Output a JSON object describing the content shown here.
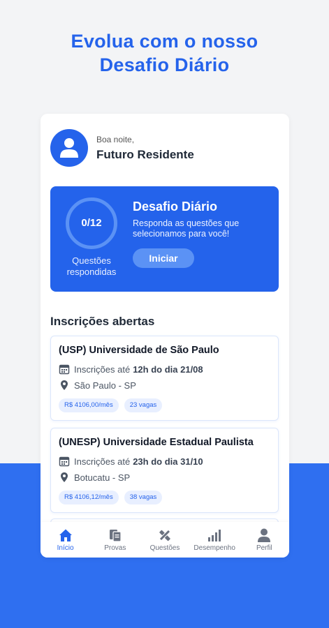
{
  "headline": {
    "line1": "Evolua com o nosso",
    "line2": "Desafio Diário"
  },
  "greeting": {
    "salutation": "Boa noite,",
    "name": "Futuro Residente"
  },
  "challenge": {
    "progress_text": "0/12",
    "progress_fraction": 0,
    "caption_line1": "Questões",
    "caption_line2": "respondidas",
    "title": "Desafio Diário",
    "description": "Responda as questões que selecionamos para você!",
    "button_label": "Iniciar"
  },
  "section_title": "Inscrições abertas",
  "cards": [
    {
      "title": "(USP) Universidade de São Paulo",
      "deadline_prefix": "Inscrições até",
      "deadline_value": "12h do dia 21/08",
      "location": "São Paulo - SP",
      "salary": "R$ 4106,00/mês",
      "vacancies": "23 vagas"
    },
    {
      "title": "(UNESP) Universidade Estadual Paulista",
      "deadline_prefix": "Inscrições até",
      "deadline_value": "23h do dia 31/10",
      "location": "Botucatu - SP",
      "salary": "R$ 4106,12/mês",
      "vacancies": "38 vagas"
    }
  ],
  "nav": [
    {
      "label": "Início",
      "icon": "home-icon",
      "active": true
    },
    {
      "label": "Provas",
      "icon": "documents-icon",
      "active": false
    },
    {
      "label": "Questões",
      "icon": "pencil-ruler-icon",
      "active": false
    },
    {
      "label": "Desempenho",
      "icon": "bar-chart-icon",
      "active": false
    },
    {
      "label": "Perfil",
      "icon": "person-icon",
      "active": false
    }
  ],
  "colors": {
    "accent": "#2563eb",
    "background_bottom": "#2f6ff0"
  }
}
